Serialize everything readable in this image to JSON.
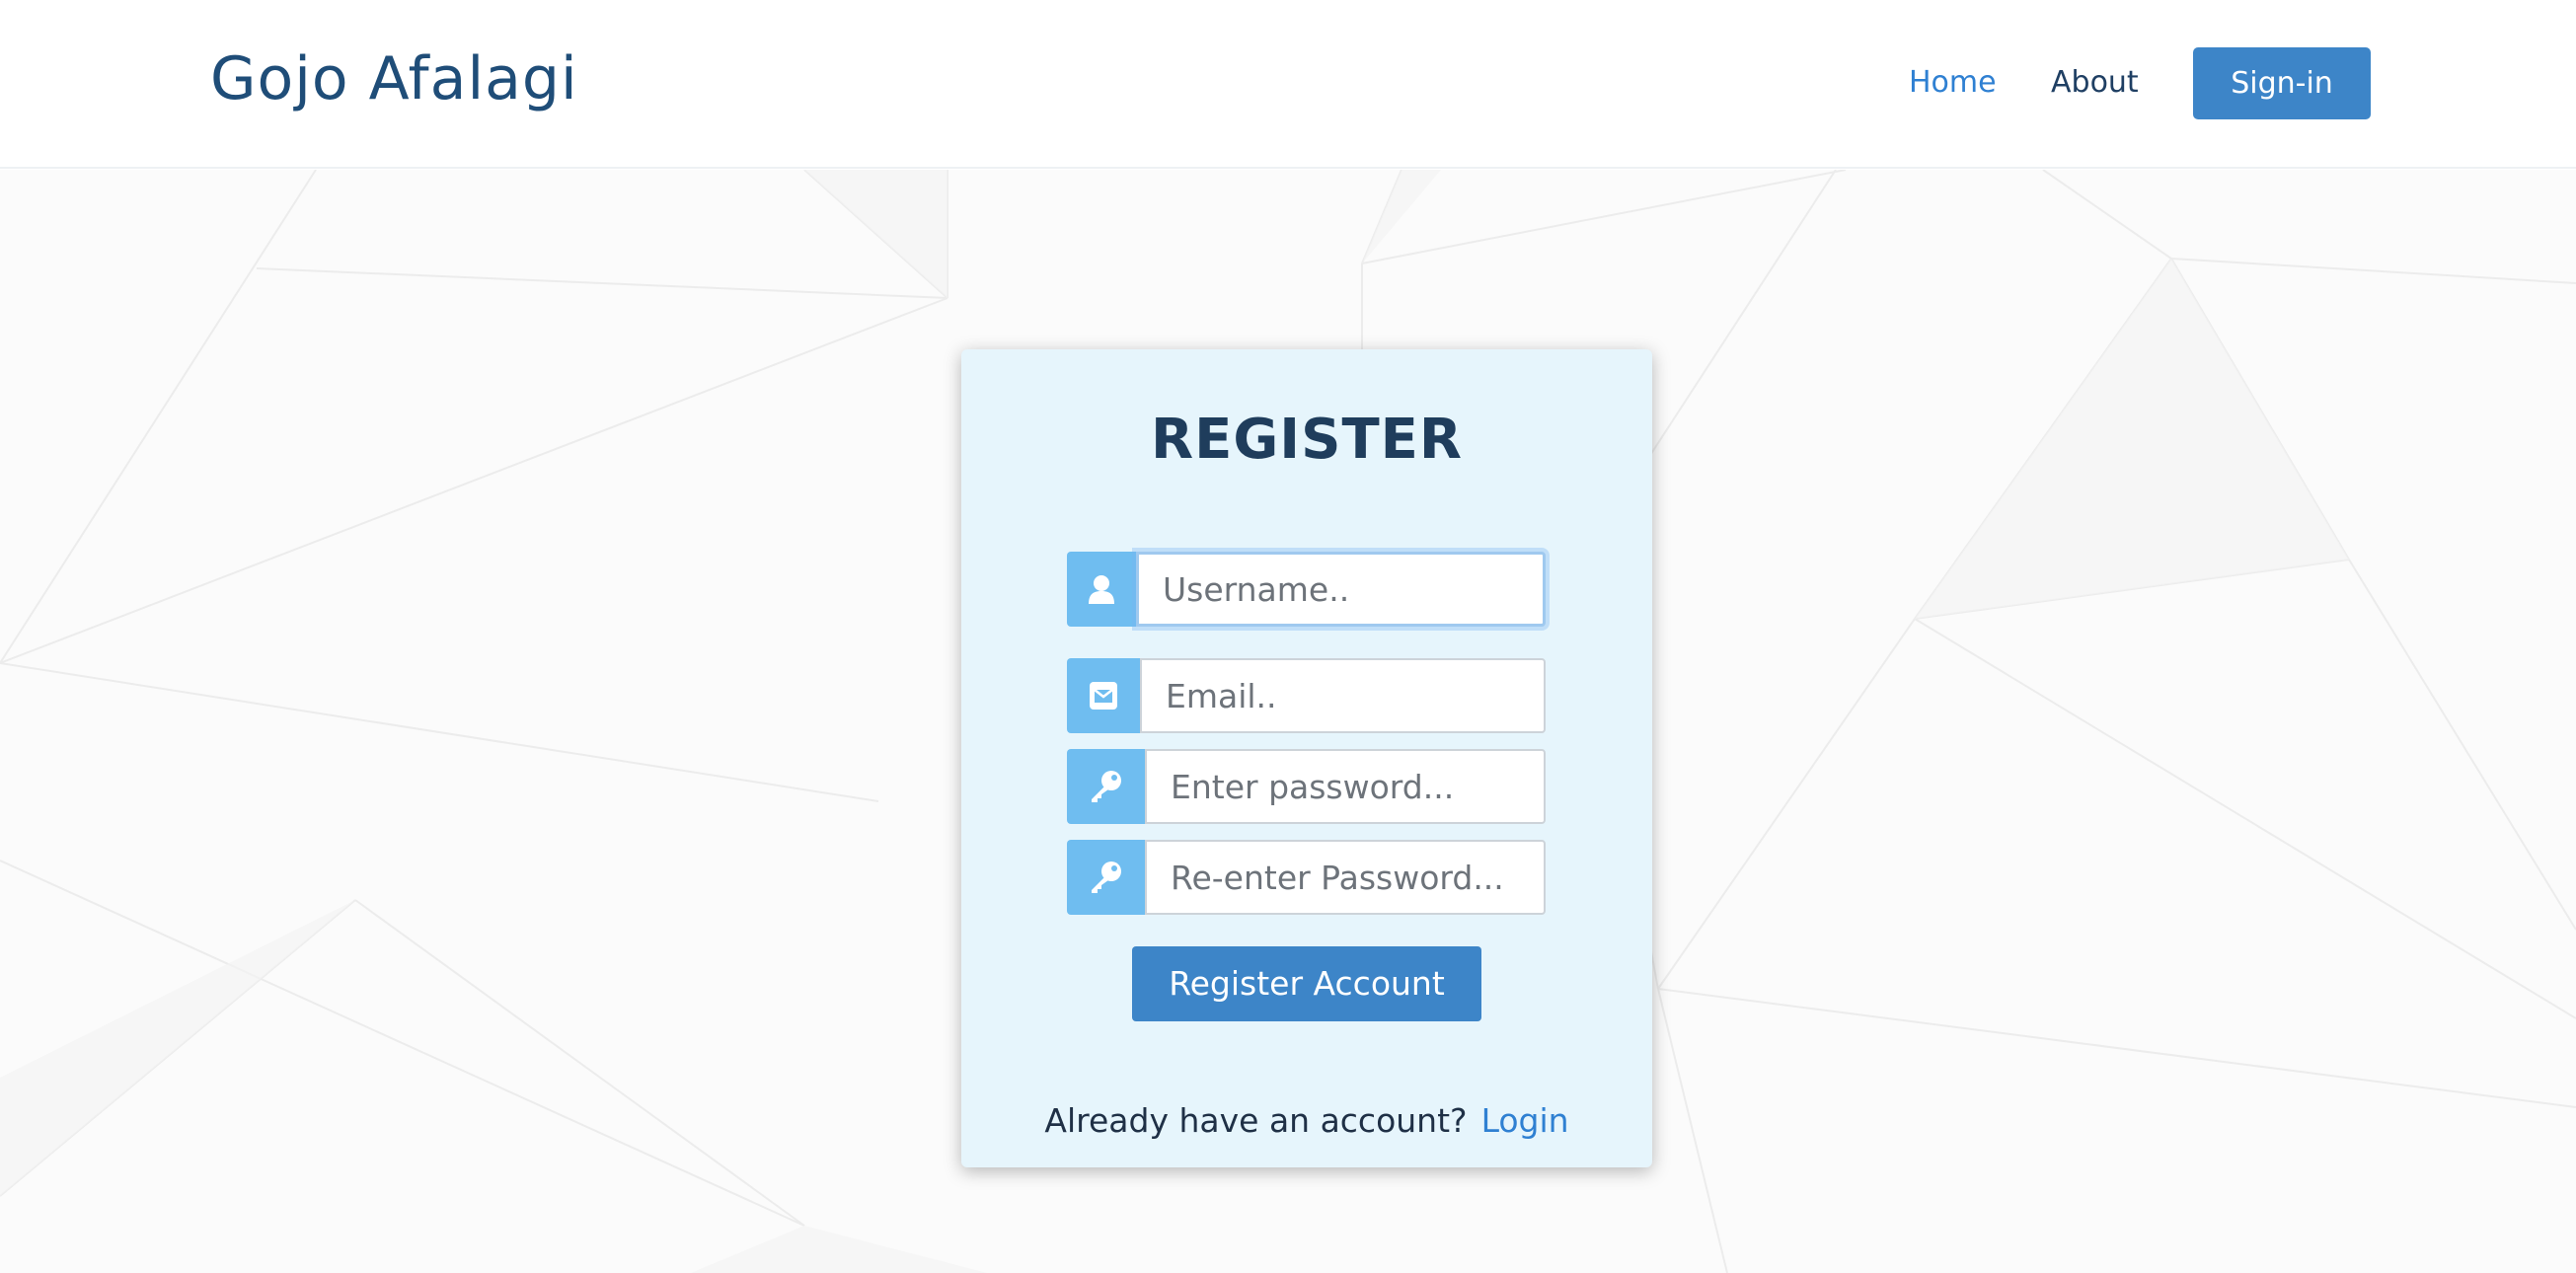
{
  "header": {
    "brand": "Gojo Afalagi",
    "nav": {
      "home": "Home",
      "about": "About",
      "signin": "Sign-in"
    }
  },
  "register": {
    "title": "REGISTER",
    "fields": {
      "username": {
        "placeholder": "Username..",
        "value": "",
        "icon": "user-icon"
      },
      "email": {
        "placeholder": "Email..",
        "value": "",
        "icon": "envelope-icon"
      },
      "password": {
        "placeholder": "Enter password...",
        "value": "",
        "icon": "key-icon"
      },
      "confirm_password": {
        "placeholder": "Re-enter Password...",
        "value": "",
        "icon": "key-icon"
      }
    },
    "submit_label": "Register Account",
    "footer_prompt": "Already have an account?",
    "login_label": "Login"
  },
  "colors": {
    "brand_text": "#1f4d78",
    "accent": "#3d85c8",
    "link": "#2f80d2",
    "card_bg": "#e6f5fc",
    "icon_bg": "#6fbdf0",
    "title_text": "#1f3d5c"
  }
}
